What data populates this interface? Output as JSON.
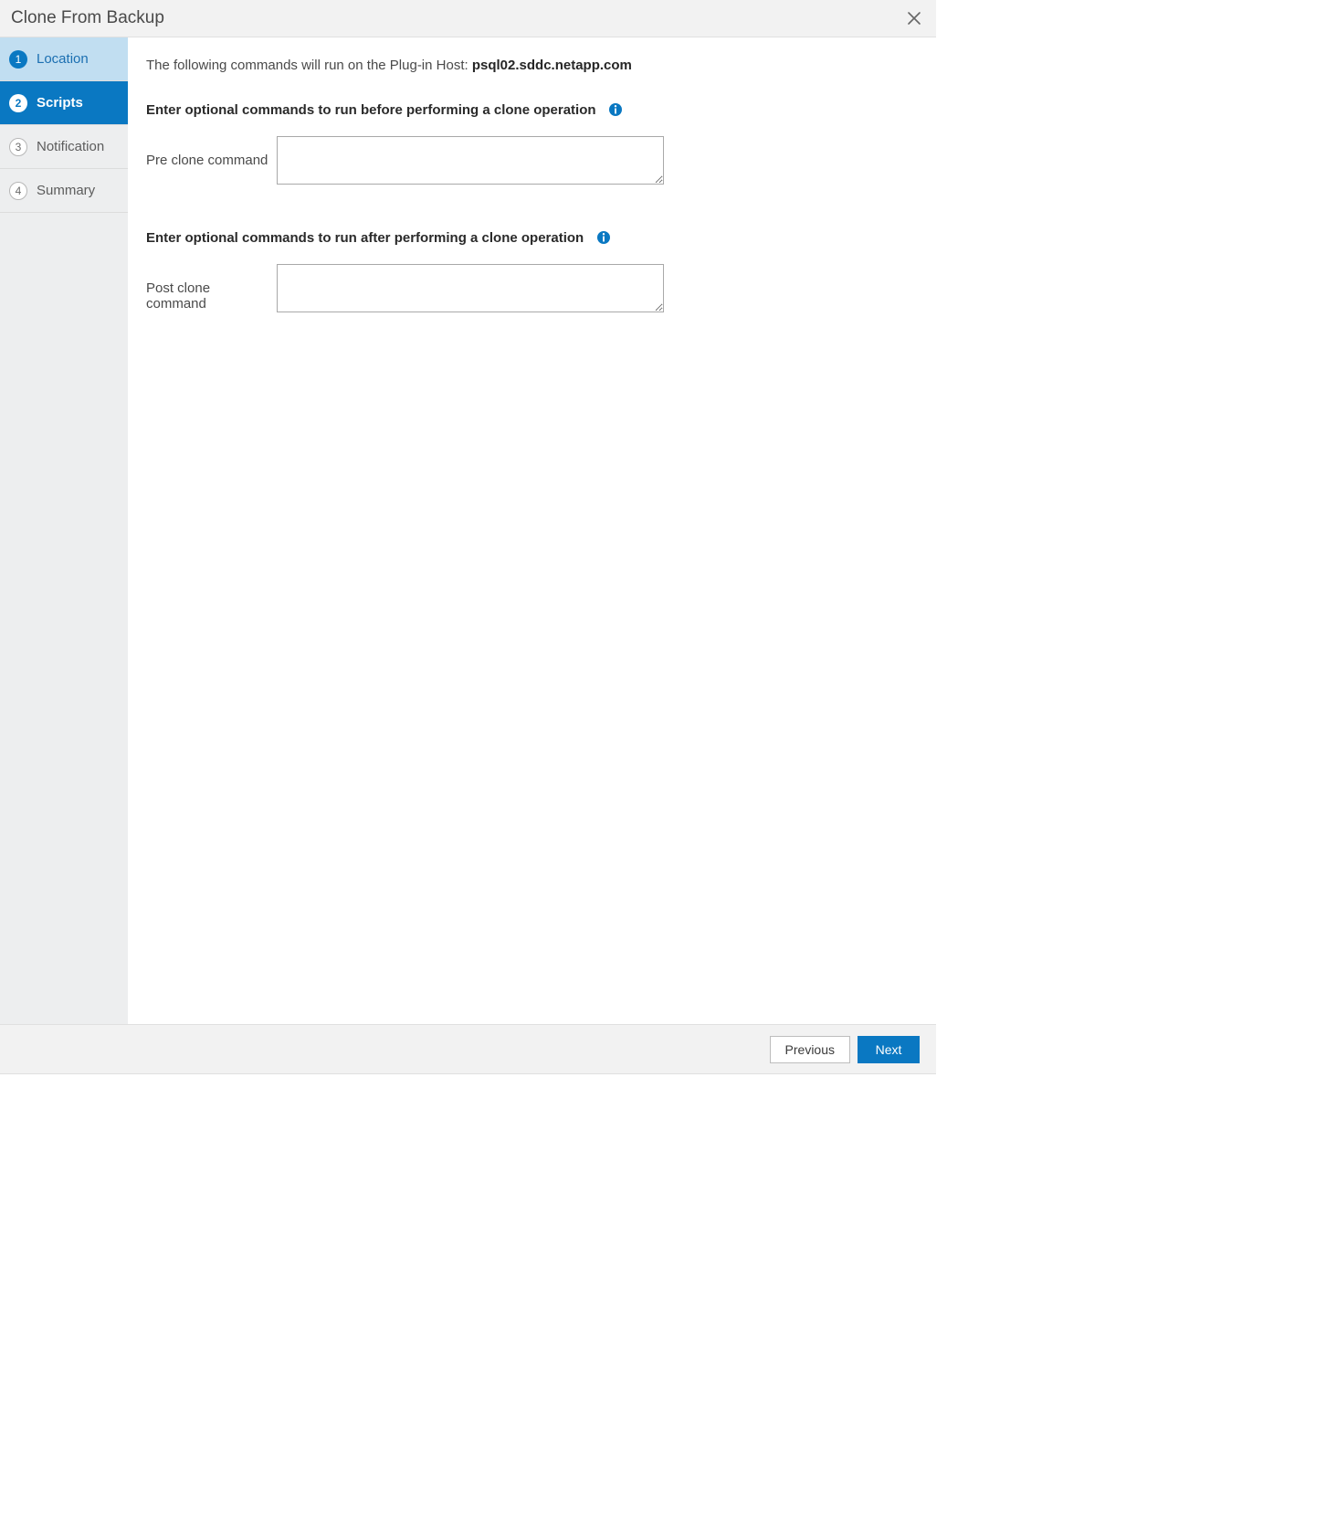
{
  "header": {
    "title": "Clone From Backup"
  },
  "sidebar": {
    "steps": [
      {
        "num": "1",
        "label": "Location"
      },
      {
        "num": "2",
        "label": "Scripts"
      },
      {
        "num": "3",
        "label": "Notification"
      },
      {
        "num": "4",
        "label": "Summary"
      }
    ]
  },
  "main": {
    "intro_prefix": "The following commands will run on the Plug-in Host: ",
    "intro_host": "psql02.sddc.netapp.com",
    "pre_section_title": "Enter optional commands to run before performing a clone operation",
    "pre_label": "Pre clone command",
    "pre_value": "",
    "post_section_title": "Enter optional commands to run after performing a clone operation",
    "post_label": "Post clone command",
    "post_value": ""
  },
  "footer": {
    "previous": "Previous",
    "next": "Next"
  }
}
